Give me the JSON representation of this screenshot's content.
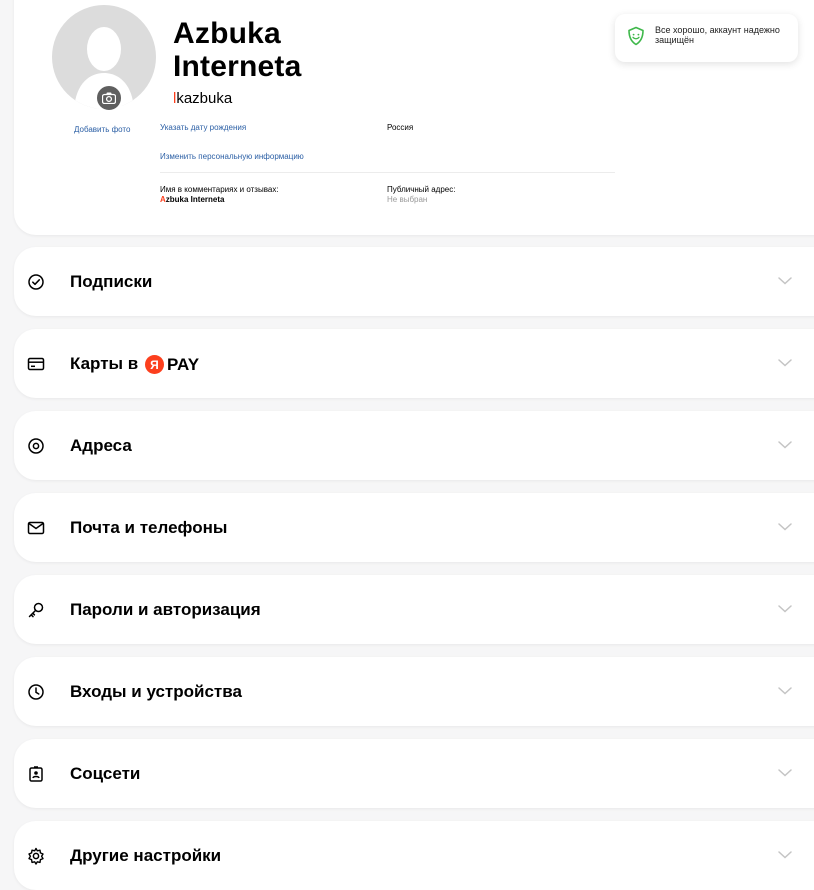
{
  "profile": {
    "name_line1": "Azbuka",
    "name_line2": "Interneta",
    "login_first": "l",
    "login_rest": "kazbuka",
    "add_photo": "Добавить фото",
    "set_birthday": "Указать дату рождения",
    "country": "Россия",
    "edit_info": "Изменить персональную информацию",
    "comments_label": "Имя в комментариях и отзывах:",
    "comments_name_first": "A",
    "comments_name_rest": "zbuka Interneta",
    "public_address_label": "Публичный адрес:",
    "public_address_value": "Не выбран"
  },
  "security": {
    "text": "Все хорошо, аккаунт надежно защищён",
    "icon": "smile-shield-icon"
  },
  "sections": [
    {
      "label": "Подписки",
      "icon": "check-circle-icon"
    },
    {
      "label": "Карты в",
      "icon": "card-icon",
      "brand_letter": "Я",
      "brand_text": "PAY"
    },
    {
      "label": "Адреса",
      "icon": "location-icon"
    },
    {
      "label": "Почта и телефоны",
      "icon": "mail-icon"
    },
    {
      "label": "Пароли и авторизация",
      "icon": "key-icon"
    },
    {
      "label": "Входы и устройства",
      "icon": "clock-icon"
    },
    {
      "label": "Соцсети",
      "icon": "badge-icon"
    },
    {
      "label": "Другие настройки",
      "icon": "gear-icon"
    }
  ],
  "colors": {
    "accent_red": "#fc3f1d",
    "link_blue": "#2b5fa5",
    "security_green": "#3fb84b",
    "background": "#f6f6f7"
  }
}
